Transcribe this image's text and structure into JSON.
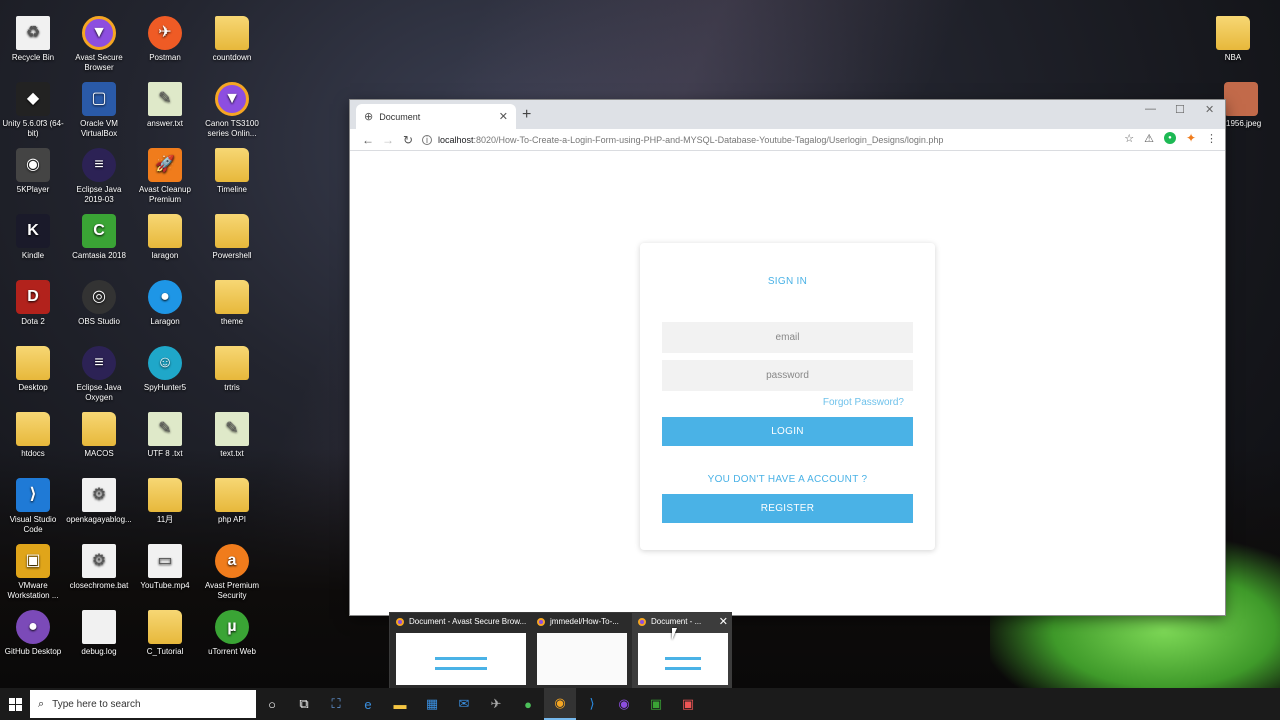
{
  "desktop": {
    "icons": [
      {
        "label": "Recycle Bin"
      },
      {
        "label": "Avast Secure Browser"
      },
      {
        "label": "Postman"
      },
      {
        "label": "countdown"
      },
      {
        "label": "Unity 5.6.0f3 (64-bit)"
      },
      {
        "label": "Oracle VM VirtualBox"
      },
      {
        "label": "answer.txt"
      },
      {
        "label": "Canon TS3100 series Onlin..."
      },
      {
        "label": "5KPlayer"
      },
      {
        "label": "Eclipse Java 2019-03"
      },
      {
        "label": "Avast Cleanup Premium"
      },
      {
        "label": "Timeline"
      },
      {
        "label": "Kindle"
      },
      {
        "label": "Camtasia 2018"
      },
      {
        "label": "laragon"
      },
      {
        "label": "Powershell"
      },
      {
        "label": "Dota 2"
      },
      {
        "label": "OBS Studio"
      },
      {
        "label": "Laragon"
      },
      {
        "label": "theme"
      },
      {
        "label": "Desktop"
      },
      {
        "label": "Eclipse Java Oxygen"
      },
      {
        "label": "SpyHunter5"
      },
      {
        "label": "trtris"
      },
      {
        "label": "htdocs"
      },
      {
        "label": "MACOS"
      },
      {
        "label": "UTF 8 .txt"
      },
      {
        "label": "text.txt"
      },
      {
        "label": "Visual Studio Code"
      },
      {
        "label": "openkagayablog..."
      },
      {
        "label": "11月"
      },
      {
        "label": "php API"
      },
      {
        "label": "VMware Workstation ..."
      },
      {
        "label": "closechrome.bat"
      },
      {
        "label": "YouTube.mp4"
      },
      {
        "label": "Avast Premium Security"
      },
      {
        "label": "GitHub Desktop"
      },
      {
        "label": "debug.log"
      },
      {
        "label": "C_Tutorial"
      },
      {
        "label": "uTorrent Web"
      },
      {
        "label": "NBA"
      },
      {
        "label": "1956.jpeg"
      }
    ]
  },
  "browser": {
    "tab_title": "Document",
    "new_tab": "+",
    "url_host": "localhost",
    "url_path": ":8020/How-To-Create-a-Login-Form-using-PHP-and-MYSQL-Database-Youtube-Tagalog/Userlogin_Designs/login.php"
  },
  "login": {
    "title": "SIGN IN",
    "email_placeholder": "email",
    "password_placeholder": "password",
    "forgot": "Forgot Password?",
    "login_label": "LOGIN",
    "no_account": "YOU DON'T HAVE A ACCOUNT ?",
    "register_label": "REGISTER"
  },
  "taskbar": {
    "search_placeholder": "Type here to search",
    "thumbnails": [
      {
        "title": "Document - Avast Secure Brow..."
      },
      {
        "title": "jmmedel/How-To-..."
      },
      {
        "title": "Document - ..."
      }
    ]
  },
  "colors": {
    "accent": "#4ab2e6"
  }
}
